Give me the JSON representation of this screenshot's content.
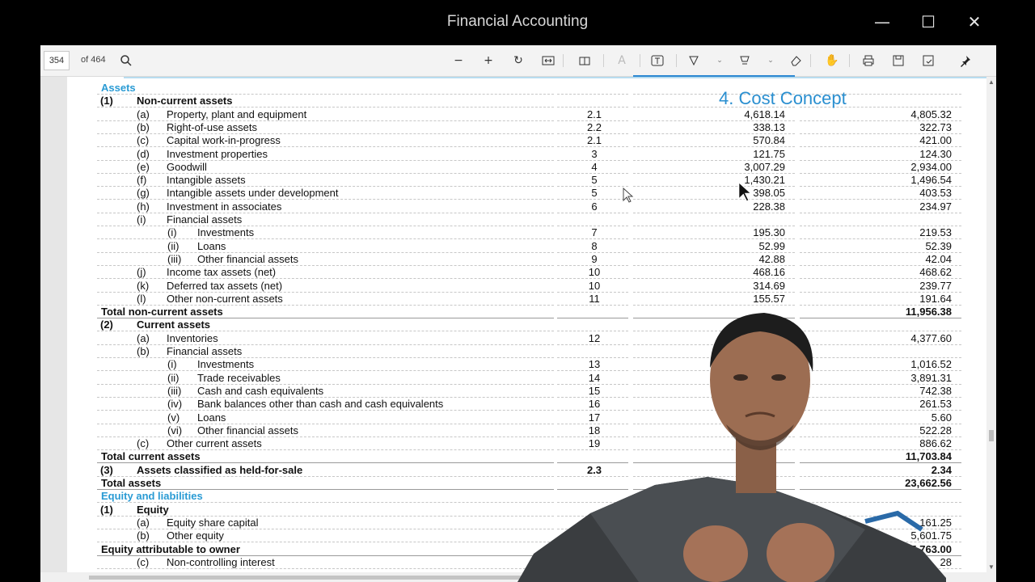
{
  "window": {
    "title": "Financial Accounting"
  },
  "toolbar": {
    "page_number": "354",
    "page_count": "of 464"
  },
  "overlay": {
    "heading": "4. Cost Concept"
  },
  "rows": [
    {
      "t": "blue",
      "num": "",
      "label": "Assets",
      "note": "",
      "v1": "",
      "v2": ""
    },
    {
      "t": "bold",
      "num": "(1)",
      "label": "Non-current assets",
      "note": "",
      "v1": "",
      "v2": ""
    },
    {
      "t": "l1",
      "num": "(a)",
      "label": "Property, plant and equipment",
      "note": "2.1",
      "v1": "4,618.14",
      "v2": "4,805.32"
    },
    {
      "t": "l1",
      "num": "(b)",
      "label": "Right-of-use assets",
      "note": "2.2",
      "v1": "338.13",
      "v2": "322.73"
    },
    {
      "t": "l1",
      "num": "(c)",
      "label": "Capital work-in-progress",
      "note": "2.1",
      "v1": "570.84",
      "v2": "421.00"
    },
    {
      "t": "l1",
      "num": "(d)",
      "label": "Investment properties",
      "note": "3",
      "v1": "121.75",
      "v2": "124.30"
    },
    {
      "t": "l1",
      "num": "(e)",
      "label": "Goodwill",
      "note": "4",
      "v1": "3,007.29",
      "v2": "2,934.00"
    },
    {
      "t": "l1",
      "num": "(f)",
      "label": "Intangible assets",
      "note": "5",
      "v1": "1,430.21",
      "v2": "1,496.54"
    },
    {
      "t": "l1",
      "num": "(g)",
      "label": "Intangible assets under development",
      "note": "5",
      "v1": "398.05",
      "v2": "403.53"
    },
    {
      "t": "l1",
      "num": "(h)",
      "label": "Investment in associates",
      "note": "6",
      "v1": "228.38",
      "v2": "234.97"
    },
    {
      "t": "l1",
      "num": "(i)",
      "label": "Financial assets",
      "note": "",
      "v1": "",
      "v2": ""
    },
    {
      "t": "l2",
      "num": "(i)",
      "label": "Investments",
      "note": "7",
      "v1": "195.30",
      "v2": "219.53"
    },
    {
      "t": "l2",
      "num": "(ii)",
      "label": "Loans",
      "note": "8",
      "v1": "52.99",
      "v2": "52.39"
    },
    {
      "t": "l2",
      "num": "(iii)",
      "label": "Other financial assets",
      "note": "9",
      "v1": "42.88",
      "v2": "42.04"
    },
    {
      "t": "l1",
      "num": "(j)",
      "label": "Income tax assets (net)",
      "note": "10",
      "v1": "468.16",
      "v2": "468.62"
    },
    {
      "t": "l1",
      "num": "(k)",
      "label": "Deferred tax assets (net)",
      "note": "10",
      "v1": "314.69",
      "v2": "239.77"
    },
    {
      "t": "l1",
      "num": "(l)",
      "label": "Other non-current assets",
      "note": "11",
      "v1": "155.57",
      "v2": "191.64"
    },
    {
      "t": "total",
      "num": "",
      "label": "Total non-current assets",
      "note": "",
      "v1": "",
      "v2": "11,956.38"
    },
    {
      "t": "bold",
      "num": "(2)",
      "label": "Current assets",
      "note": "",
      "v1": "",
      "v2": ""
    },
    {
      "t": "l1",
      "num": "(a)",
      "label": "Inventories",
      "note": "12",
      "v1": "",
      "v2": "4,377.60"
    },
    {
      "t": "l1",
      "num": "(b)",
      "label": "Financial assets",
      "note": "",
      "v1": "",
      "v2": ""
    },
    {
      "t": "l2",
      "num": "(i)",
      "label": "Investments",
      "note": "13",
      "v1": "",
      "v2": "1,016.52"
    },
    {
      "t": "l2",
      "num": "(ii)",
      "label": "Trade receivables",
      "note": "14",
      "v1": "",
      "v2": "3,891.31"
    },
    {
      "t": "l2",
      "num": "(iii)",
      "label": "Cash and cash equivalents",
      "note": "15",
      "v1": "",
      "v2": "742.38"
    },
    {
      "t": "l2",
      "num": "(iv)",
      "label": "Bank balances other than cash and cash equivalents",
      "note": "16",
      "v1": "",
      "v2": "261.53"
    },
    {
      "t": "l2",
      "num": "(v)",
      "label": "Loans",
      "note": "17",
      "v1": "",
      "v2": "5.60"
    },
    {
      "t": "l2",
      "num": "(vi)",
      "label": "Other financial assets",
      "note": "18",
      "v1": "",
      "v2": "522.28"
    },
    {
      "t": "l1",
      "num": "(c)",
      "label": "Other current assets",
      "note": "19",
      "v1": "",
      "v2": "886.62"
    },
    {
      "t": "total",
      "num": "",
      "label": "Total current assets",
      "note": "",
      "v1": "",
      "v2": "11,703.84"
    },
    {
      "t": "bold",
      "num": "(3)",
      "label": "Assets classified as held-for-sale",
      "note": "2.3",
      "v1": "",
      "v2": "2.34"
    },
    {
      "t": "total",
      "num": "",
      "label": "Total assets",
      "note": "",
      "v1": "",
      "v2": "23,662.56"
    },
    {
      "t": "blue",
      "num": "",
      "label": "Equity and liabilities",
      "note": "",
      "v1": "",
      "v2": ""
    },
    {
      "t": "bold",
      "num": "(1)",
      "label": "Equity",
      "note": "",
      "v1": "",
      "v2": ""
    },
    {
      "t": "l1",
      "num": "(a)",
      "label": "Equity share capital",
      "note": "",
      "v1": "",
      "v2": "161.25"
    },
    {
      "t": "l1",
      "num": "(b)",
      "label": "Other equity",
      "note": "",
      "v1": "",
      "v2": "5,601.75"
    },
    {
      "t": "total",
      "num": "",
      "label": "Equity attributable to owner",
      "note": "",
      "v1": "",
      "v2": "5,763.00"
    },
    {
      "t": "l1",
      "num": "(c)",
      "label": "Non-controlling interest",
      "note": "",
      "v1": "",
      "v2": "28"
    }
  ]
}
